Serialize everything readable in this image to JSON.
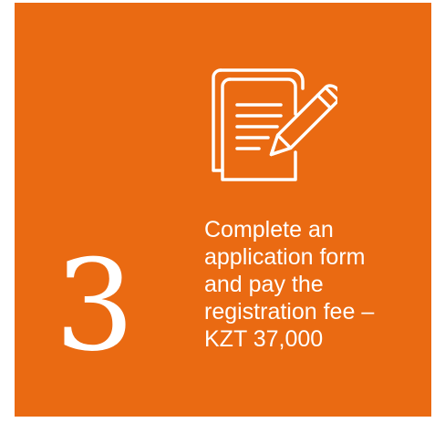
{
  "step": {
    "number": "3",
    "description": "Complete an\napplication form\nand pay the\nregistration fee –\nKZT 37,000"
  },
  "icon": {
    "name": "form-pencil-icon"
  },
  "colors": {
    "background": "#ea6a12",
    "foreground": "#ffffff"
  }
}
